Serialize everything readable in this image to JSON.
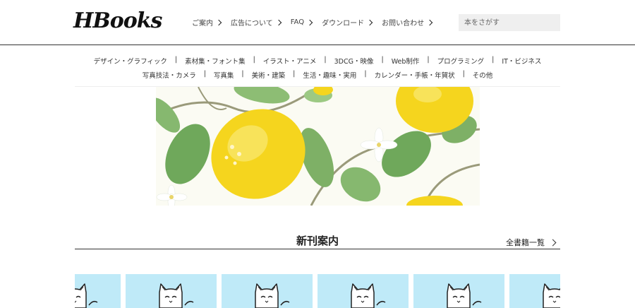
{
  "header": {
    "logo": "HBooks",
    "nav": [
      {
        "label": "ご案内"
      },
      {
        "label": "広告について"
      },
      {
        "label": "FAQ"
      },
      {
        "label": "ダウンロード"
      },
      {
        "label": "お問い合わせ"
      }
    ],
    "search_placeholder": "本をさがす"
  },
  "categories": {
    "row1": [
      "デザイン・グラフィック",
      "素材集・フォント集",
      "イラスト・アニメ",
      "3DCG・映像",
      "Web制作",
      "プログラミング",
      "IT・ビジネス"
    ],
    "row2": [
      "写真技法・カメラ",
      "写真集",
      "美術・建築",
      "生活・趣味・実用",
      "カレンダー・手帳・年賀状",
      "その他"
    ],
    "separator": "|"
  },
  "section": {
    "title": "新刊案内",
    "all_link": "全書籍一覧"
  },
  "colors": {
    "book_cover_bg": "#bfeaf8",
    "lemon": "#f5d51e",
    "leaf": "#6fa85b"
  }
}
